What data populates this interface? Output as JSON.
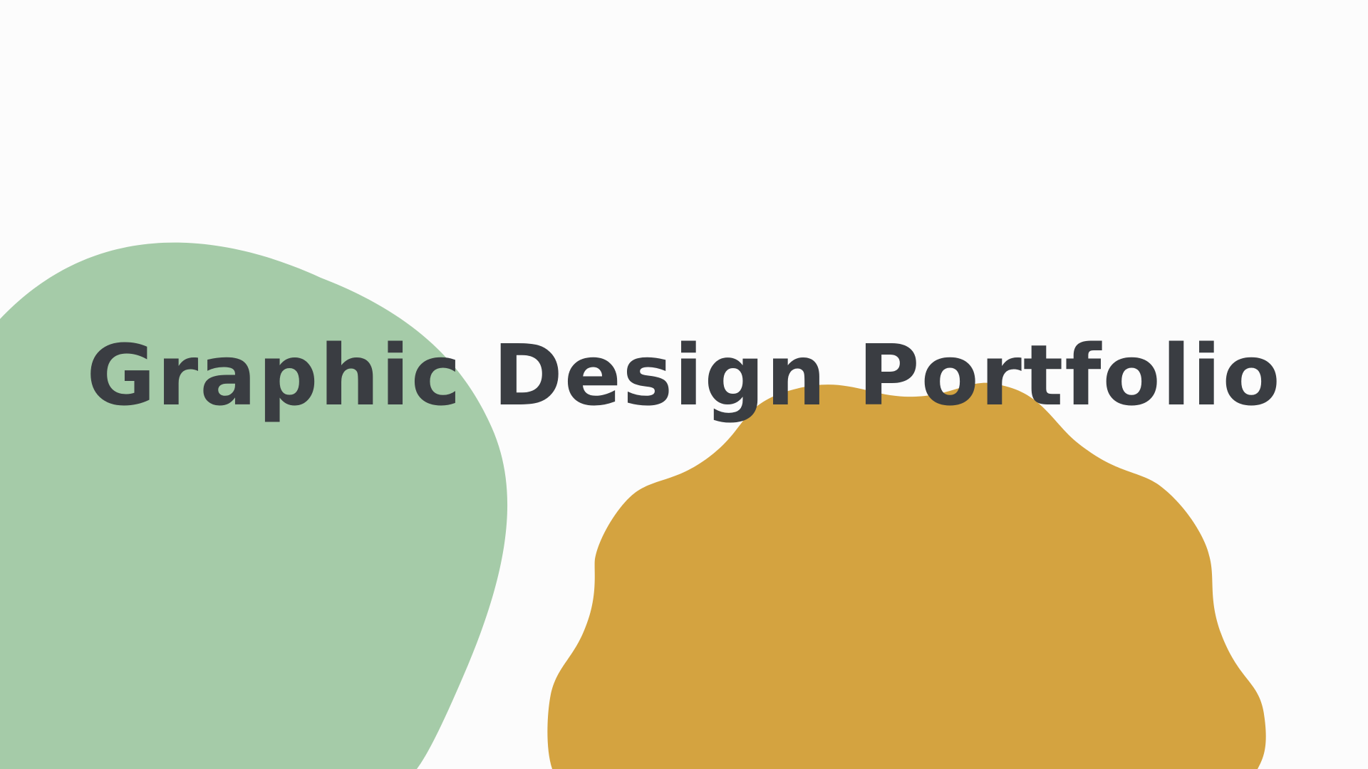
{
  "slide": {
    "title": "Graphic Design Portfolio"
  },
  "colors": {
    "background": "#fcfcfc",
    "green_blob": "#a5cba8",
    "mustard_blob": "#d4a340",
    "title_text": "#3a3d42"
  }
}
